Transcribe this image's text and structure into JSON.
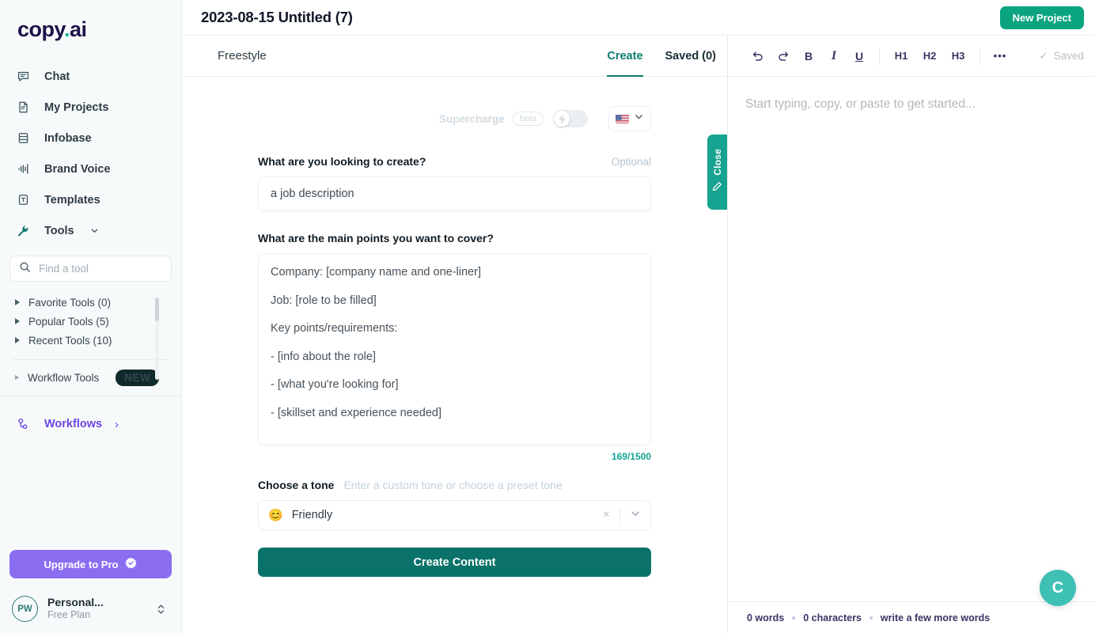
{
  "sidebar": {
    "logo": {
      "main": "copy",
      "dot": ".",
      "suffix": "ai"
    },
    "nav": [
      {
        "label": "Chat",
        "icon": "chat-bubble-icon"
      },
      {
        "label": "My Projects",
        "icon": "document-icon"
      },
      {
        "label": "Infobase",
        "icon": "database-icon"
      },
      {
        "label": "Brand Voice",
        "icon": "waveform-icon"
      },
      {
        "label": "Templates",
        "icon": "template-icon"
      },
      {
        "label": "Tools",
        "icon": "wrench-icon"
      }
    ],
    "search": {
      "placeholder": "Find a tool",
      "value": "",
      "icon": "search-icon"
    },
    "tool_groups": [
      {
        "label": "Favorite Tools (0)"
      },
      {
        "label": "Popular Tools (5)"
      },
      {
        "label": "Recent Tools (10)"
      }
    ],
    "workflow_tools": {
      "label": "Workflow Tools",
      "badge": "NEW"
    },
    "workflows": {
      "label": "Workflows",
      "icon": "workflow-icon",
      "chevron": "›"
    },
    "upgrade": {
      "label": "Upgrade to Pro",
      "icon": "verified-badge-icon"
    },
    "account": {
      "initials": "PW",
      "name": "Personal...",
      "plan": "Free Plan"
    }
  },
  "topbar": {
    "title": "2023-08-15 Untitled (7)",
    "new_project": "New Project"
  },
  "form": {
    "mode_label": "Freestyle",
    "tabs": [
      {
        "label": "Create",
        "active": true
      },
      {
        "label": "Saved (0)",
        "active": false
      }
    ],
    "supercharge": {
      "label": "Supercharge",
      "beta": "beta",
      "enabled": false,
      "icon": "lightning-bolt-icon"
    },
    "language": {
      "flag": "us-flag-icon",
      "chevron": "chevron-down-icon"
    },
    "field1": {
      "label": "What are you looking to create?",
      "optional": "Optional",
      "value": "a job description",
      "placeholder": "a job description"
    },
    "field2": {
      "label": "What are the main points you want to cover?",
      "lines": [
        "Company: [company name and one-liner]",
        "Job: [role to be filled]",
        "Key points/requirements:",
        "- [info about the role]",
        "- [what you're looking for]",
        "- [skillset and experience needed]"
      ],
      "counter": "169/1500"
    },
    "tone": {
      "label": "Choose a tone",
      "hint": "Enter a custom tone or choose a preset tone",
      "emoji": "😊",
      "value": "Friendly",
      "clear": "×"
    },
    "submit": "Create Content",
    "close_tab": {
      "label": "Close",
      "icon": "pencil-icon"
    }
  },
  "editor": {
    "toolbar": {
      "undo": "↶",
      "redo": "↷",
      "bold": "B",
      "italic": "I",
      "underline": "U",
      "h1": "H1",
      "h2": "H2",
      "h3": "H3",
      "more": "•••",
      "saved": "Saved",
      "check": "✓"
    },
    "placeholder": "Start typing, copy, or paste to get started...",
    "footer": {
      "words": "0 words",
      "characters": "0 characters",
      "hint": "write a few more words"
    },
    "fab": {
      "label": "C",
      "name": "copyai-assistant-button"
    }
  },
  "colors": {
    "teal": "#0e7c72",
    "teal_btn": "#0a7268",
    "green": "#0aa47f",
    "purple": "#6b46e5",
    "upgrade_purple": "#8b6df0",
    "counter_teal": "#12a594",
    "close_tab": "#16a391",
    "fab": "#3fc0b5",
    "sidebar_bg": "#f7fafa"
  }
}
